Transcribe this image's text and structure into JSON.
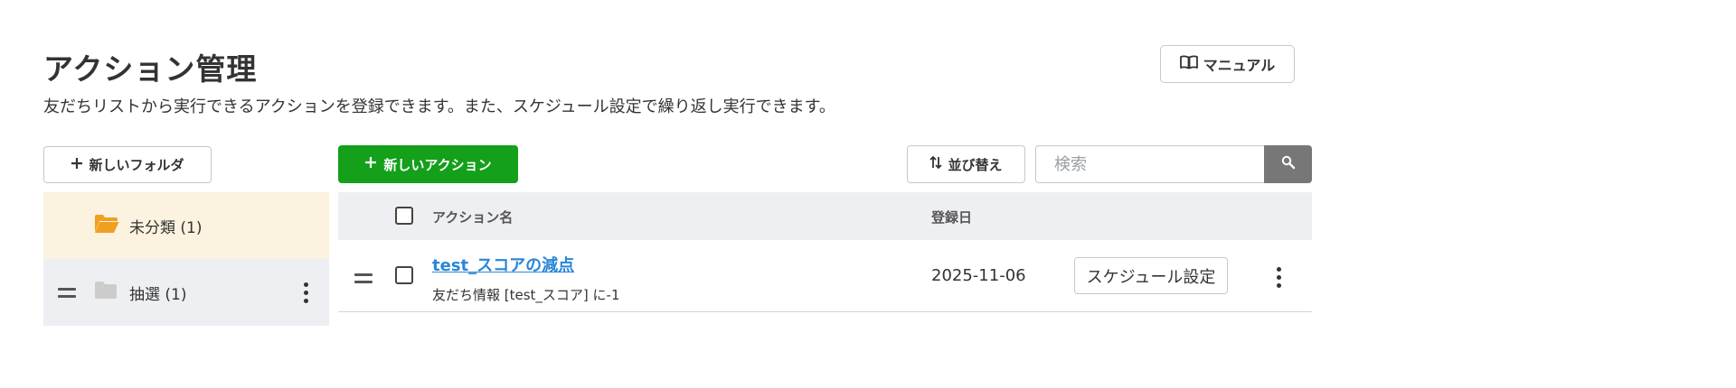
{
  "header": {
    "title": "アクション管理",
    "description": "友だちリストから実行できるアクションを登録できます。また、スケジュール設定で繰り返し実行できます。",
    "manual_label": "マニュアル"
  },
  "sidebar": {
    "new_folder_label": "新しいフォルダ",
    "folders": [
      {
        "label": "未分類 (1)",
        "selected": true,
        "icon": "folder-open-icon"
      },
      {
        "label": "抽選 (1)",
        "selected": false,
        "icon": "folder-icon"
      }
    ]
  },
  "toolbar": {
    "new_action_label": "新しいアクション",
    "sort_label": "並び替え",
    "search_placeholder": "検索",
    "search_value": ""
  },
  "table": {
    "columns": {
      "name": "アクション名",
      "date": "登録日"
    },
    "rows": [
      {
        "title": "test_スコアの減点",
        "subtitle": "友だち情報 [test_スコア] に-1",
        "date": "2025-11-06",
        "schedule_label": "スケジュール設定"
      }
    ]
  },
  "colors": {
    "primary_green": "#14a01a",
    "link_blue": "#2a86d6",
    "selected_folder_bg": "#fcf2e0",
    "folder_orange": "#f0a020",
    "search_button_gray": "#777777"
  }
}
